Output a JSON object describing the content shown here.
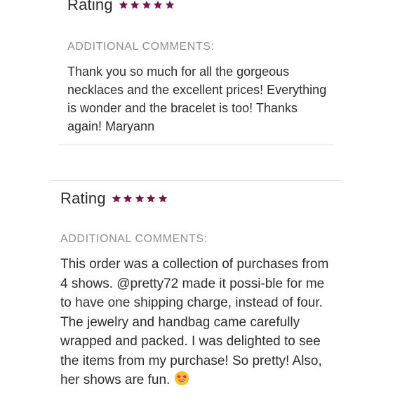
{
  "reviews": [
    {
      "rating_label": "Rating",
      "stars": 5,
      "comments_label": "ADDITIONAL COMMENTS:",
      "comment": "Thank you so much for all the gorgeous necklaces and the excellent prices! Everything is wonder and the bracelet is too! Thanks again! Maryann"
    },
    {
      "rating_label": "Rating",
      "stars": 5,
      "comments_label": "ADDITIONAL COMMENTS:",
      "comment": "This order was a collection of purchases from 4 shows. @pretty72 made it possi-ble for me to have one shipping charge, instead of four. The jewelry and handbag came carefully wrapped and packed. I was delighted to see the items from my purchase! So pretty! Also, her shows are fun.",
      "emoji": "star-struck-emoji"
    }
  ],
  "colors": {
    "star": "#7a1450",
    "divider": "#dcdcdc",
    "label_gray": "#8f8f8f"
  }
}
